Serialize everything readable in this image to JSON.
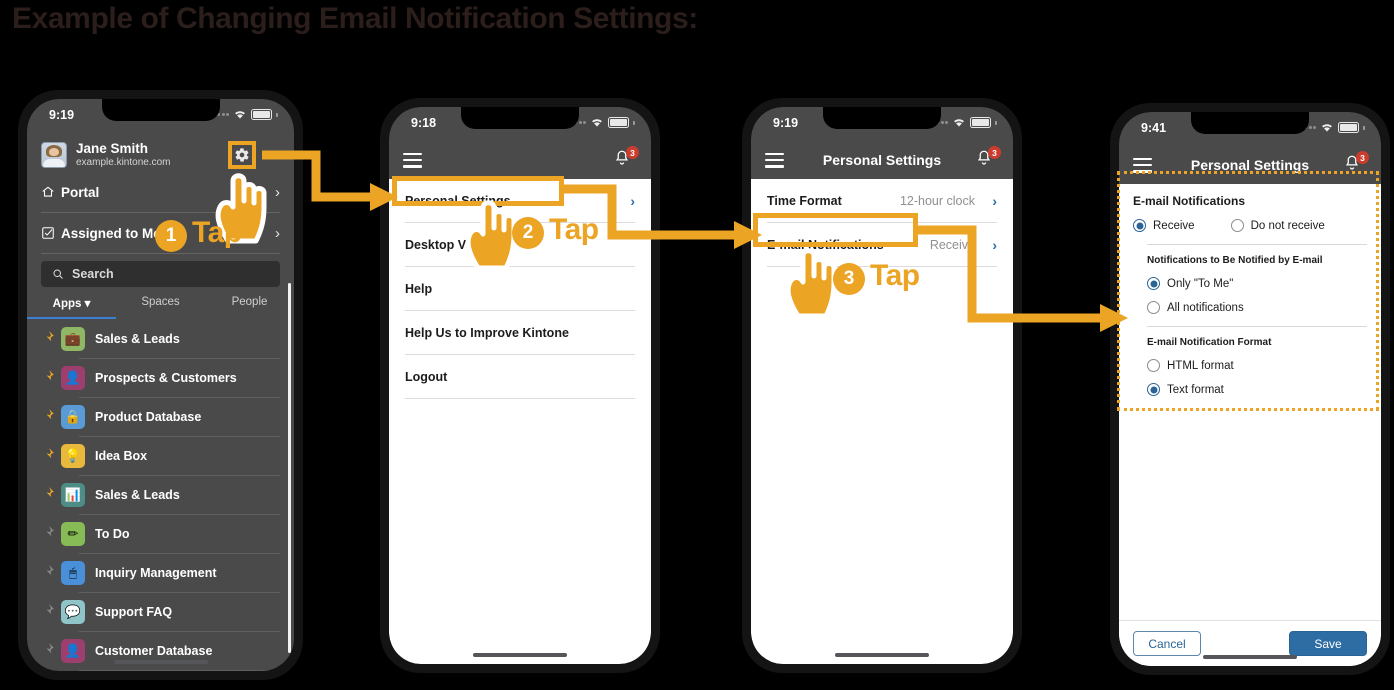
{
  "title": "Example of Changing Email Notification Settings:",
  "colors": {
    "accent": "#eba424",
    "title_text": "#2b1e1b",
    "background": "#000000",
    "phone_chrome": "#4a4a4a",
    "badge_red": "#cc3c2e",
    "link_blue": "#2f6fa8",
    "save_blue": "#2e6da4",
    "tab_underline": "#3b7fd4"
  },
  "phone1": {
    "status": {
      "time": "9:19"
    },
    "user": {
      "name": "Jane Smith",
      "domain": "example.kintone.com"
    },
    "gear_icon": "gear-icon",
    "caret_icon": "chevron-down-icon",
    "rows": [
      {
        "icon": "home-icon",
        "label": "Portal"
      },
      {
        "icon": "checkbox-icon",
        "label": "Assigned to Me"
      }
    ],
    "search": {
      "placeholder": "Search",
      "icon": "search-icon"
    },
    "tabs": [
      {
        "label": "Apps ▾",
        "active": true
      },
      {
        "label": "Spaces",
        "active": false
      },
      {
        "label": "People",
        "active": false
      }
    ],
    "apps": [
      {
        "label": "Sales & Leads",
        "pinned": true,
        "icon": "briefcase-icon",
        "bg": "#8fb765",
        "glyph": "💼"
      },
      {
        "label": "Prospects & Customers",
        "pinned": true,
        "icon": "person-card-icon",
        "bg": "#9c3f6e",
        "glyph": "👤"
      },
      {
        "label": "Product Database",
        "pinned": true,
        "icon": "lock-icon",
        "bg": "#5b9bd5",
        "glyph": "🔒"
      },
      {
        "label": "Idea Box",
        "pinned": true,
        "icon": "lightbulb-icon",
        "bg": "#e8b93a",
        "glyph": "💡"
      },
      {
        "label": "Sales & Leads",
        "pinned": true,
        "icon": "bar-chart-icon",
        "bg": "#4d8d86",
        "glyph": "📊"
      },
      {
        "label": "To Do",
        "pinned": false,
        "icon": "pencil-icon",
        "bg": "#86bb55",
        "glyph": "✏"
      },
      {
        "label": "Inquiry Management",
        "pinned": false,
        "icon": "mouse-icon",
        "bg": "#4a90d9",
        "glyph": "🖱"
      },
      {
        "label": "Support FAQ",
        "pinned": false,
        "icon": "speech-bubble-icon",
        "bg": "#8fc4c9",
        "glyph": "💬"
      },
      {
        "label": "Customer Database",
        "pinned": false,
        "icon": "person-card-icon",
        "bg": "#9c3f6e",
        "glyph": "👤"
      }
    ]
  },
  "phone2": {
    "status": {
      "time": "9:18"
    },
    "nav": {
      "menu_icon": "hamburger-icon",
      "bell_icon": "bell-icon",
      "badge": "3"
    },
    "items": [
      {
        "label": "Personal Settings",
        "chevron": true
      },
      {
        "label": "Desktop View",
        "chevron": false
      },
      {
        "label": "Help",
        "chevron": false
      },
      {
        "label": "Help Us to Improve Kintone",
        "chevron": false
      },
      {
        "label": "Logout",
        "chevron": false
      }
    ]
  },
  "phone3": {
    "status": {
      "time": "9:19"
    },
    "nav": {
      "title": "Personal Settings",
      "menu_icon": "hamburger-icon",
      "bell_icon": "bell-icon",
      "badge": "3"
    },
    "items": [
      {
        "label": "Time Format",
        "value": "12-hour clock"
      },
      {
        "label": "E-mail Notifications",
        "value": "Receive"
      }
    ]
  },
  "phone4": {
    "status": {
      "time": "9:41"
    },
    "nav": {
      "title": "Personal Settings",
      "menu_icon": "hamburger-icon",
      "bell_icon": "bell-icon",
      "badge": "3"
    },
    "section_title": "E-mail Notifications",
    "receive_group": [
      {
        "label": "Receive",
        "selected": true
      },
      {
        "label": "Do not receive",
        "selected": false
      }
    ],
    "notify_group_title": "Notifications to Be Notified by E-mail",
    "notify_group": [
      {
        "label": "Only \"To Me\"",
        "selected": true
      },
      {
        "label": "All notifications",
        "selected": false
      }
    ],
    "format_group_title": "E-mail Notification Format",
    "format_group": [
      {
        "label": "HTML format",
        "selected": false
      },
      {
        "label": "Text format",
        "selected": true
      }
    ],
    "buttons": {
      "cancel": "Cancel",
      "save": "Save"
    }
  },
  "steps": [
    {
      "number": "❶",
      "word": "Tap"
    },
    {
      "number": "❷",
      "word": "Tap"
    },
    {
      "number": "❸",
      "word": "Tap"
    }
  ]
}
